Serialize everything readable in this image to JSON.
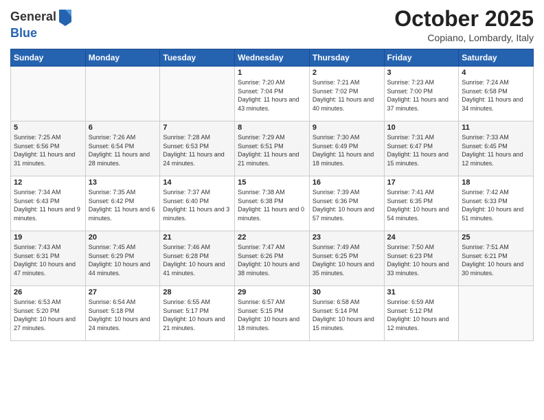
{
  "logo": {
    "general": "General",
    "blue": "Blue"
  },
  "title": "October 2025",
  "subtitle": "Copiano, Lombardy, Italy",
  "days_of_week": [
    "Sunday",
    "Monday",
    "Tuesday",
    "Wednesday",
    "Thursday",
    "Friday",
    "Saturday"
  ],
  "weeks": [
    [
      {
        "day": "",
        "info": ""
      },
      {
        "day": "",
        "info": ""
      },
      {
        "day": "",
        "info": ""
      },
      {
        "day": "1",
        "info": "Sunrise: 7:20 AM\nSunset: 7:04 PM\nDaylight: 11 hours and 43 minutes."
      },
      {
        "day": "2",
        "info": "Sunrise: 7:21 AM\nSunset: 7:02 PM\nDaylight: 11 hours and 40 minutes."
      },
      {
        "day": "3",
        "info": "Sunrise: 7:23 AM\nSunset: 7:00 PM\nDaylight: 11 hours and 37 minutes."
      },
      {
        "day": "4",
        "info": "Sunrise: 7:24 AM\nSunset: 6:58 PM\nDaylight: 11 hours and 34 minutes."
      }
    ],
    [
      {
        "day": "5",
        "info": "Sunrise: 7:25 AM\nSunset: 6:56 PM\nDaylight: 11 hours and 31 minutes."
      },
      {
        "day": "6",
        "info": "Sunrise: 7:26 AM\nSunset: 6:54 PM\nDaylight: 11 hours and 28 minutes."
      },
      {
        "day": "7",
        "info": "Sunrise: 7:28 AM\nSunset: 6:53 PM\nDaylight: 11 hours and 24 minutes."
      },
      {
        "day": "8",
        "info": "Sunrise: 7:29 AM\nSunset: 6:51 PM\nDaylight: 11 hours and 21 minutes."
      },
      {
        "day": "9",
        "info": "Sunrise: 7:30 AM\nSunset: 6:49 PM\nDaylight: 11 hours and 18 minutes."
      },
      {
        "day": "10",
        "info": "Sunrise: 7:31 AM\nSunset: 6:47 PM\nDaylight: 11 hours and 15 minutes."
      },
      {
        "day": "11",
        "info": "Sunrise: 7:33 AM\nSunset: 6:45 PM\nDaylight: 11 hours and 12 minutes."
      }
    ],
    [
      {
        "day": "12",
        "info": "Sunrise: 7:34 AM\nSunset: 6:43 PM\nDaylight: 11 hours and 9 minutes."
      },
      {
        "day": "13",
        "info": "Sunrise: 7:35 AM\nSunset: 6:42 PM\nDaylight: 11 hours and 6 minutes."
      },
      {
        "day": "14",
        "info": "Sunrise: 7:37 AM\nSunset: 6:40 PM\nDaylight: 11 hours and 3 minutes."
      },
      {
        "day": "15",
        "info": "Sunrise: 7:38 AM\nSunset: 6:38 PM\nDaylight: 11 hours and 0 minutes."
      },
      {
        "day": "16",
        "info": "Sunrise: 7:39 AM\nSunset: 6:36 PM\nDaylight: 10 hours and 57 minutes."
      },
      {
        "day": "17",
        "info": "Sunrise: 7:41 AM\nSunset: 6:35 PM\nDaylight: 10 hours and 54 minutes."
      },
      {
        "day": "18",
        "info": "Sunrise: 7:42 AM\nSunset: 6:33 PM\nDaylight: 10 hours and 51 minutes."
      }
    ],
    [
      {
        "day": "19",
        "info": "Sunrise: 7:43 AM\nSunset: 6:31 PM\nDaylight: 10 hours and 47 minutes."
      },
      {
        "day": "20",
        "info": "Sunrise: 7:45 AM\nSunset: 6:29 PM\nDaylight: 10 hours and 44 minutes."
      },
      {
        "day": "21",
        "info": "Sunrise: 7:46 AM\nSunset: 6:28 PM\nDaylight: 10 hours and 41 minutes."
      },
      {
        "day": "22",
        "info": "Sunrise: 7:47 AM\nSunset: 6:26 PM\nDaylight: 10 hours and 38 minutes."
      },
      {
        "day": "23",
        "info": "Sunrise: 7:49 AM\nSunset: 6:25 PM\nDaylight: 10 hours and 35 minutes."
      },
      {
        "day": "24",
        "info": "Sunrise: 7:50 AM\nSunset: 6:23 PM\nDaylight: 10 hours and 33 minutes."
      },
      {
        "day": "25",
        "info": "Sunrise: 7:51 AM\nSunset: 6:21 PM\nDaylight: 10 hours and 30 minutes."
      }
    ],
    [
      {
        "day": "26",
        "info": "Sunrise: 6:53 AM\nSunset: 5:20 PM\nDaylight: 10 hours and 27 minutes."
      },
      {
        "day": "27",
        "info": "Sunrise: 6:54 AM\nSunset: 5:18 PM\nDaylight: 10 hours and 24 minutes."
      },
      {
        "day": "28",
        "info": "Sunrise: 6:55 AM\nSunset: 5:17 PM\nDaylight: 10 hours and 21 minutes."
      },
      {
        "day": "29",
        "info": "Sunrise: 6:57 AM\nSunset: 5:15 PM\nDaylight: 10 hours and 18 minutes."
      },
      {
        "day": "30",
        "info": "Sunrise: 6:58 AM\nSunset: 5:14 PM\nDaylight: 10 hours and 15 minutes."
      },
      {
        "day": "31",
        "info": "Sunrise: 6:59 AM\nSunset: 5:12 PM\nDaylight: 10 hours and 12 minutes."
      },
      {
        "day": "",
        "info": ""
      }
    ]
  ]
}
